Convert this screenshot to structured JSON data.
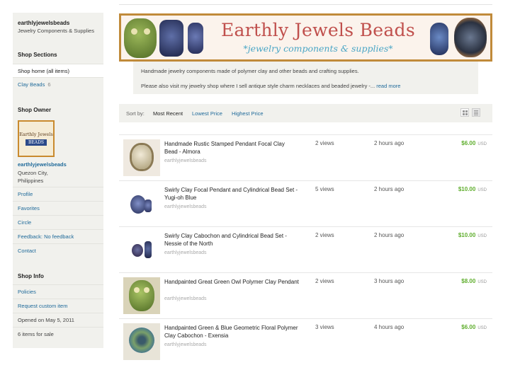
{
  "sidebar": {
    "shop_name": "earthlyjewelsbeads",
    "shop_description": "Jewelry Components & Supplies",
    "sections_title": "Shop Sections",
    "sections": [
      {
        "label": "Shop home (all items)",
        "count": ""
      },
      {
        "label": "Clay Beads",
        "count": "6"
      }
    ],
    "owner_title": "Shop Owner",
    "avatar_text_top": "Earthly Jewels",
    "avatar_text_bottom": "BEADS",
    "owner_name": "earthlyjewelsbeads",
    "owner_location": "Quezon City, Philippines",
    "owner_links": [
      "Profile",
      "Favorites",
      "Circle",
      "Feedback: No feedback",
      "Contact"
    ],
    "info_title": "Shop Info",
    "info_links": [
      "Policies",
      "Request custom item"
    ],
    "opened": "Opened on May 5, 2011",
    "items_for_sale": "6 items for sale"
  },
  "banner": {
    "title": "Earthly Jewels Beads",
    "subtitle": "*jewelry components & supplies*"
  },
  "announcement": {
    "line1": "Handmade jewelry components made of polymer clay and other beads and crafting supplies.",
    "line2": "Please also visit my jewelry shop where I sell antique style charm necklaces and beaded jewelry -...",
    "read_more": "read more"
  },
  "sort": {
    "label": "Sort by:",
    "options": [
      "Most Recent",
      "Lowest Price",
      "Highest Price"
    ],
    "selected": "Most Recent"
  },
  "listings": [
    {
      "title": "Handmade Rustic Stamped Pendant Focal Clay Bead - Almora",
      "shop": "earthlyjewelsbeads",
      "views": "2 views",
      "time": "2 hours ago",
      "price": "$6.00",
      "currency": "USD"
    },
    {
      "title": "Swirly Clay Focal Pendant and Cylindrical Bead Set - Yugi-oh Blue",
      "shop": "earthlyjewelsbeads",
      "views": "5 views",
      "time": "2 hours ago",
      "price": "$10.00",
      "currency": "USD"
    },
    {
      "title": "Swirly Clay Cabochon and Cylindrical Bead Set - Nessie of the North",
      "shop": "earthlyjewelsbeads",
      "views": "2 views",
      "time": "2 hours ago",
      "price": "$10.00",
      "currency": "USD"
    },
    {
      "title": "Handpainted Great Green Owl Polymer Clay Pendant",
      "shop": "earthlyjewelsbeads",
      "views": "2 views",
      "time": "3 hours ago",
      "price": "$8.00",
      "currency": "USD"
    },
    {
      "title": "Handpainted Green & Blue Geometric Floral Polymer Clay Cabochon - Exensia",
      "shop": "earthlyjewelsbeads",
      "views": "3 views",
      "time": "4 hours ago",
      "price": "$6.00",
      "currency": "USD"
    }
  ],
  "colors": {
    "link": "#1f6a9a",
    "price": "#5fae2d",
    "banner_title": "#c0504d",
    "banner_subtitle": "#4aa6c6",
    "panel_bg": "#f1f1ed"
  }
}
